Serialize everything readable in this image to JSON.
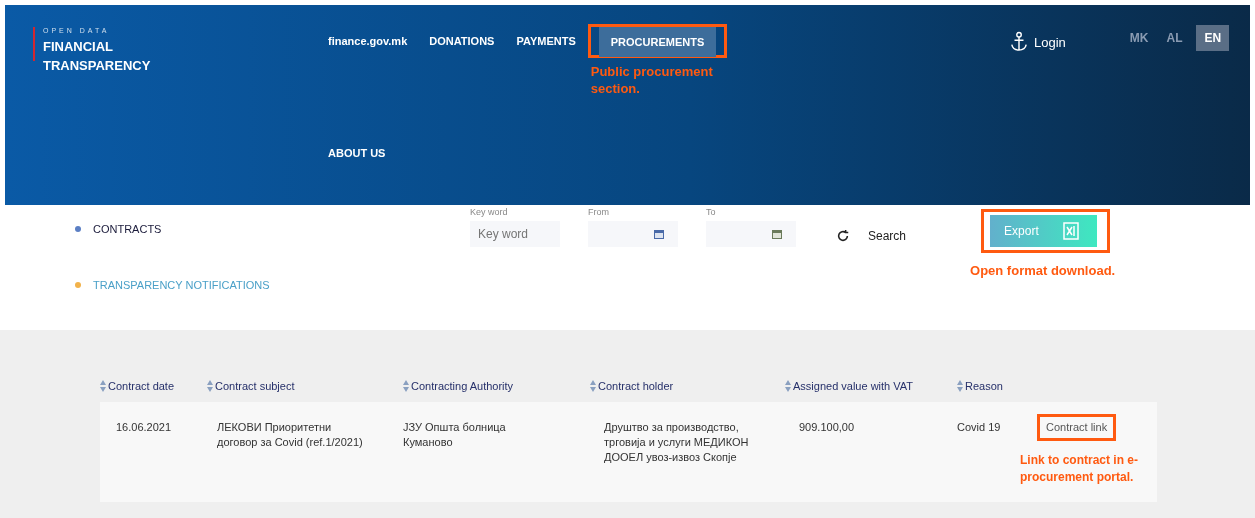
{
  "header": {
    "logo": {
      "kicker": "OPEN DATA",
      "title": "FINANCIAL TRANSPARENCY"
    },
    "nav": [
      {
        "label": "finance.gov.mk",
        "selected": false,
        "highlighted": false
      },
      {
        "label": "DONATIONS",
        "selected": false,
        "highlighted": false
      },
      {
        "label": "PAYMENTS",
        "selected": false,
        "highlighted": false
      },
      {
        "label": "PROCUREMENTS",
        "selected": true,
        "highlighted": true,
        "callout": "Public procurement section."
      },
      {
        "label": "ABOUT US",
        "selected": false,
        "highlighted": false
      }
    ],
    "login": "Login",
    "languages": [
      {
        "label": "MK",
        "selected": false
      },
      {
        "label": "AL",
        "selected": false
      },
      {
        "label": "EN",
        "selected": true
      }
    ]
  },
  "sidebar": [
    {
      "label": "CONTRACTS",
      "color": "#5b7fc4",
      "selected": true
    },
    {
      "label": "TRANSPARENCY NOTIFICATIONS",
      "color": "#f2b24a",
      "selected": false
    }
  ],
  "filters": {
    "keyword": {
      "label": "Key word",
      "placeholder": "Key word"
    },
    "from": {
      "label": "From"
    },
    "to": {
      "label": "To"
    },
    "search": "Search",
    "export": {
      "label": "Export",
      "highlighted": true,
      "callout": "Open format download."
    }
  },
  "table": {
    "columns": [
      "Contract date",
      "Contract subject",
      "Contracting Authority",
      "Contract holder",
      "Assigned value with VAT",
      "Reason"
    ],
    "rows": [
      {
        "cells": [
          "16.06.2021",
          "ЛЕКОВИ Приоритетни договор за Covid (ref.1/2021)",
          "ЈЗУ Општа болница Куманово",
          "Друштво за производство, трговија и услуги МЕДИКОН ДООЕЛ увоз-извоз Скопје",
          "909.100,00",
          "Covid 19"
        ],
        "link": "Contract link",
        "highlighted": true,
        "callout": "Link to contract in e-procurement portal."
      }
    ]
  }
}
